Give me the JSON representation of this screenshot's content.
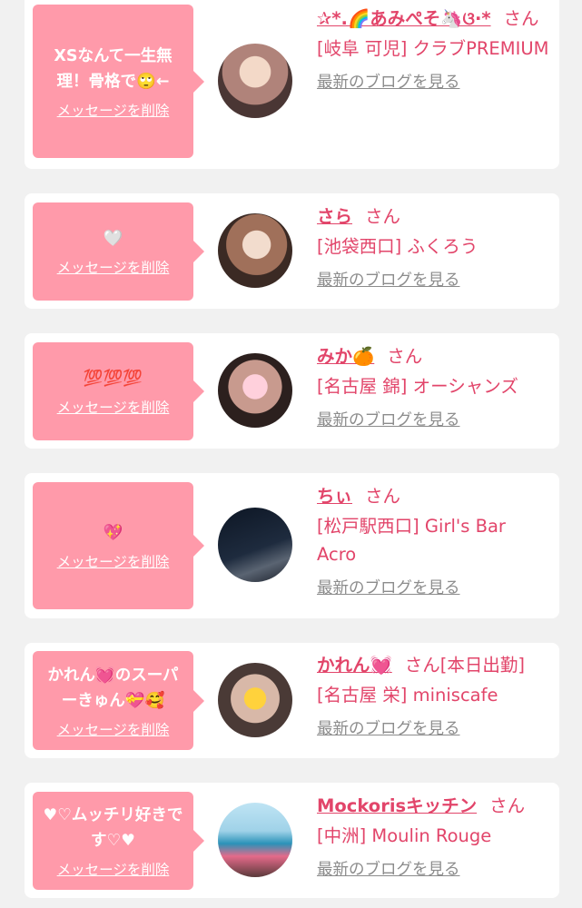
{
  "colors": {
    "accent": "#e2456a",
    "bubble": "#ff9aaa",
    "background": "#f1f1f1",
    "link_gray": "#8c8c8c"
  },
  "cards": [
    {
      "message": "XSなんて一生無理！骨格で🙄←",
      "delete_label": "メッセージを削除",
      "name": "✰*.🌈あみぺそ🦄ଓ·*",
      "san": "さん",
      "shop": "[岐阜 可児] クラブPREMIUM",
      "blog_label": "最新のブログを見る"
    },
    {
      "message": "🤍",
      "delete_label": "メッセージを削除",
      "name": "さら",
      "san": "さん",
      "shop": "[池袋西口] ふくろう",
      "blog_label": "最新のブログを見る"
    },
    {
      "message": "💯💯💯",
      "delete_label": "メッセージを削除",
      "name": "みか🍊",
      "san": "さん",
      "shop": "[名古屋 錦] オーシャンズ",
      "blog_label": "最新のブログを見る"
    },
    {
      "message": "💖",
      "delete_label": "メッセージを削除",
      "name": "ちぃ",
      "san": "さん",
      "shop": "[松戸駅西口] Girl's Bar Acro",
      "blog_label": "最新のブログを見る"
    },
    {
      "message": "かれん💓のスーパーきゅん💝🥰",
      "delete_label": "メッセージを削除",
      "name": "かれん💓",
      "san": "さん[本日出勤]",
      "shop": "[名古屋 栄] miniscafe",
      "blog_label": "最新のブログを見る"
    },
    {
      "message": "♥♡ムッチリ好きです♡♥",
      "delete_label": "メッセージを削除",
      "name": "Mockorisキッチン",
      "san": "さん",
      "shop": "[中洲] Moulin Rouge",
      "blog_label": "最新のブログを見る"
    }
  ]
}
